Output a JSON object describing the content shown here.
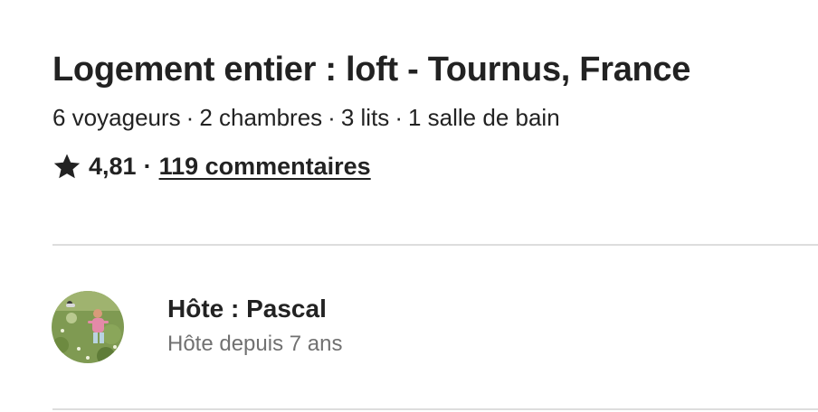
{
  "listing": {
    "title": "Logement entier : loft - Tournus, France",
    "overview": {
      "guests": "6 voyageurs",
      "bedrooms": "2 chambres",
      "beds": "3 lits",
      "baths": "1 salle de bain",
      "separator": "·"
    },
    "rating": {
      "icon": "star-icon",
      "value": "4,81",
      "separator": "·",
      "reviews_label": "119 commentaires"
    }
  },
  "host": {
    "name_label": "Hôte : Pascal",
    "since_label": "Hôte depuis 7 ans",
    "avatar": "host-avatar-photo"
  },
  "colors": {
    "text_primary": "#222222",
    "text_secondary": "#717171",
    "divider": "#dddddd"
  }
}
